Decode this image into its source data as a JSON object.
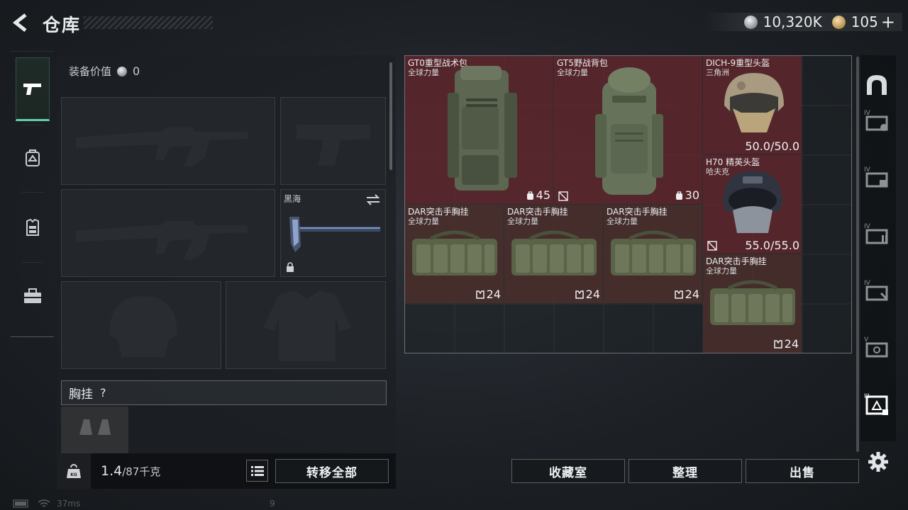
{
  "header": {
    "title": "仓库",
    "silver_amount": "10,320K",
    "gold_amount": "105",
    "plus_label": "+"
  },
  "left_nav": {
    "items": [
      "pistol-icon",
      "backpack-icon",
      "armor-vest-icon",
      "toolbox-icon"
    ],
    "active": 0
  },
  "equipment": {
    "value_label": "装备价值",
    "value": "0",
    "melee_slot_label": "黑海",
    "chest_section_title": "胸挂",
    "help_label": "?",
    "weight_current": "1.4",
    "weight_max": "/87千克",
    "weight_icon_label": "KG",
    "transfer_all_label": "转移全部"
  },
  "storage": {
    "items": [
      {
        "name": "GT0重型战术包",
        "sub": "全球力量",
        "capacity": "45",
        "bg": "red"
      },
      {
        "name": "GT5野战背包",
        "sub": "全球力量",
        "capacity": "30",
        "bg": "red"
      },
      {
        "name": "DICH-9重型头盔",
        "sub": "三角洲",
        "durability": "50.0/50.0",
        "bg": "red"
      },
      {
        "name": "H70 精英头盔",
        "sub": "哈夫克",
        "durability": "55.0/55.0",
        "bg": "red"
      },
      {
        "name": "DAR突击手胸挂",
        "sub": "全球力量",
        "capacity": "24",
        "bg": "brown"
      },
      {
        "name": "DAR突击手胸挂",
        "sub": "全球力量",
        "capacity": "24",
        "bg": "brown"
      },
      {
        "name": "DAR突击手胸挂",
        "sub": "全球力量",
        "capacity": "24",
        "bg": "brown"
      },
      {
        "name": "DAR突击手胸挂",
        "sub": "全球力量",
        "capacity": "24",
        "bg": "brown"
      }
    ]
  },
  "actions": {
    "collection_label": "收藏室",
    "sort_label": "整理",
    "sell_label": "出售"
  },
  "right_rail": {
    "tiers": [
      "",
      "IV",
      "IV",
      "IV",
      "IV",
      "V",
      "III"
    ]
  },
  "status": {
    "ping": "37ms",
    "fps": "9"
  },
  "colors": {
    "accent_green": "#5fd0a8",
    "item_red": "#64262d",
    "item_brown": "#4e302c"
  }
}
